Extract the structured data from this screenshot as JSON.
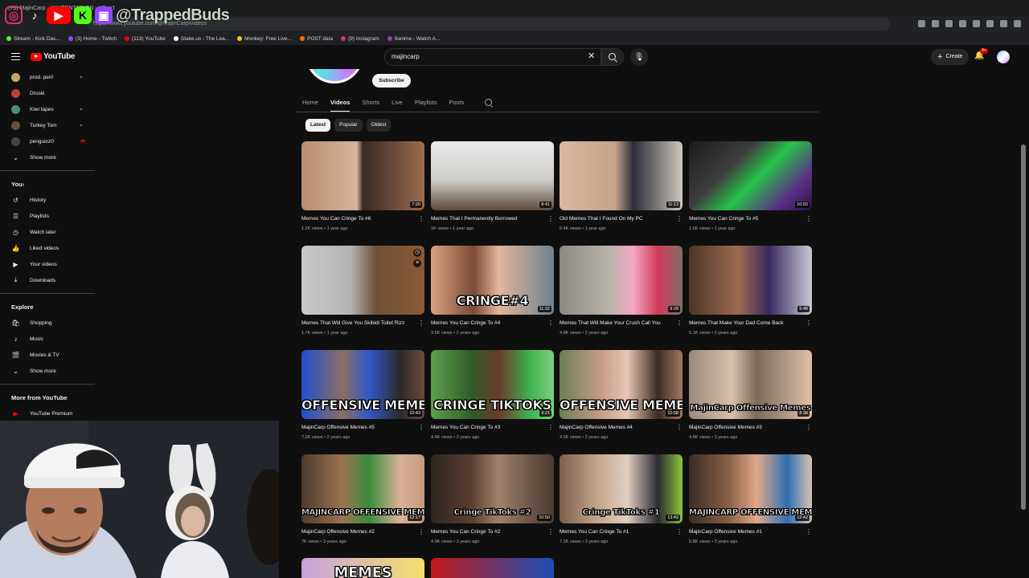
{
  "browser": {
    "tab_title": "(79) MajinCarp · XXXTENTACION - I Don't",
    "url": "https://www.youtube.com/@MajinCarp/videos",
    "watermark": "@TrappedBuds",
    "bookmarks": [
      {
        "label": "Stream - Kick Das...",
        "color": "#53fc18"
      },
      {
        "label": "(3) Home - Twitch",
        "color": "#9146ff"
      },
      {
        "label": "(113) YouTube",
        "color": "#ff0000"
      },
      {
        "label": "Stake.us - The Lea...",
        "color": "#ffffff"
      },
      {
        "label": "Monkey: Free Live...",
        "color": "#f5c518"
      },
      {
        "label": "POST data",
        "color": "#ff6d00"
      },
      {
        "label": "(9) Instagram",
        "color": "#e1306c"
      },
      {
        "label": "9anime - Watch A...",
        "color": "#8e44ad"
      }
    ]
  },
  "header": {
    "logo": "YouTube",
    "search_value": "majincarp",
    "create_label": "Create",
    "notif_count": "9+"
  },
  "sidebar": {
    "subscriptions": [
      {
        "label": "prod. peril",
        "color": "#c9a26b",
        "dot": true
      },
      {
        "label": "Druski",
        "color": "#b5432f",
        "dot": false
      },
      {
        "label": "Kiwi tapes",
        "color": "#4a8f7a",
        "dot": true
      },
      {
        "label": "Turkey Tom",
        "color": "#6a4c3c",
        "dot": true
      },
      {
        "label": "penguinz0",
        "color": "#444",
        "live": true
      }
    ],
    "show_more": "Show more",
    "you_heading": "You",
    "you_items": [
      {
        "label": "History",
        "icon": "history-icon",
        "glyph": "↺"
      },
      {
        "label": "Playlists",
        "icon": "playlists-icon",
        "glyph": "☰"
      },
      {
        "label": "Watch later",
        "icon": "clock-icon",
        "glyph": "◷"
      },
      {
        "label": "Liked videos",
        "icon": "thumbs-up-icon",
        "glyph": "👍"
      },
      {
        "label": "Your videos",
        "icon": "video-icon",
        "glyph": "▶"
      },
      {
        "label": "Downloads",
        "icon": "download-icon",
        "glyph": "⤓"
      }
    ],
    "explore_heading": "Explore",
    "explore_items": [
      {
        "label": "Shopping",
        "icon": "shopping-bag-icon",
        "glyph": "🛍"
      },
      {
        "label": "Music",
        "icon": "music-icon",
        "glyph": "♪"
      },
      {
        "label": "Movies & TV",
        "icon": "clapperboard-icon",
        "glyph": "🎬"
      }
    ],
    "explore_show_more": "Show more",
    "more_heading": "More from YouTube",
    "more_items": [
      {
        "label": "YouTube Premium",
        "icon": "youtube-premium-icon"
      }
    ]
  },
  "channel": {
    "subscribe_label": "Subscribe",
    "tabs": [
      "Home",
      "Videos",
      "Shorts",
      "Live",
      "Playlists",
      "Posts"
    ],
    "active_tab": "Videos",
    "chips": [
      "Latest",
      "Popular",
      "Oldest"
    ],
    "active_chip": "Latest"
  },
  "videos": [
    {
      "title": "Memes You Can Cringe To #6",
      "views": "1.2K views",
      "age": "1 year ago",
      "duration": "7:20",
      "overlay": "",
      "bg": "linear-gradient(90deg,#b98d6e 0%,#d8b49a 45%,#3a2a24 50%,#9c6b4e 100%)"
    },
    {
      "title": "Memes That I Permanently Borrowed",
      "views": "1K views",
      "age": "1 year ago",
      "duration": "8:41",
      "overlay": "",
      "bg": "linear-gradient(180deg,#e9e9e9 0%,#d0cfcb 55%,#5c4b3d 100%)"
    },
    {
      "title": "Old Memes That I Found On My PC",
      "views": "6.4K views",
      "age": "1 year ago",
      "duration": "11:13",
      "overlay": "",
      "bg": "linear-gradient(90deg,#d9b89f 0%,#c6a388 45%,#2d2e3a 60%,#cfc6bd 100%)"
    },
    {
      "title": "Memes You Can Cringe To #5",
      "views": "1.6K views",
      "age": "1 year ago",
      "duration": "10:02",
      "overlay": "",
      "bg": "linear-gradient(135deg,#1b1b1b 0%,#3e3e3e 35%,#27c24a 55%,#5a2f86 80%,#2a1440 100%)"
    },
    {
      "title": "Memes That Will Give You Skibidi Toilet Rizz",
      "views": "1.7K views",
      "age": "1 year ago",
      "duration": "",
      "overlay": "",
      "bg": "linear-gradient(90deg,#c9c9c9 0%,#b4b4b4 40%,#6e5138 60%,#8b5a36 100%)",
      "hover": true
    },
    {
      "title": "Memes You Can Cringe To #4",
      "views": "3.5K views",
      "age": "2 years ago",
      "duration": "11:32",
      "overlay": "CRINGE#4",
      "bg": "linear-gradient(90deg,#d9a07e 0%,#7a4b37 35%,#e2b69a 55%,#6d8290 100%)"
    },
    {
      "title": "Memes That Will Make Your Crush Call You",
      "views": "4.8K views",
      "age": "2 years ago",
      "duration": "9:28",
      "overlay": "",
      "bg": "linear-gradient(90deg,#8c8a84 0%,#b7b3aa 40%,#f4a7c5 60%,#d33a5a 80%,#7b6e63 100%)"
    },
    {
      "title": "Memes That Make Your Dad Come Back",
      "views": "5.1K views",
      "age": "2 years ago",
      "duration": "9:48",
      "overlay": "",
      "bg": "linear-gradient(90deg,#4e3527 0%,#9c6a50 40%,#3a2a60 65%,#c9c9d6 100%)"
    },
    {
      "title": "MajinCarp Offensive Memes #5",
      "views": "7.2K views",
      "age": "2 years ago",
      "duration": "10:43",
      "overlay": "OFFENSIVE MEMES",
      "bg": "linear-gradient(90deg,#1f4fd0 0%,#8a6f63 33%,#3258c9 55%,#2a2a2a 80%,#6b4a3b 100%)"
    },
    {
      "title": "Memes You Can Cringe To #3",
      "views": "4.4K views",
      "age": "2 years ago",
      "duration": "9:21",
      "overlay": "CRINGE TIKTOKS",
      "bg": "linear-gradient(90deg,#5da14b 0%,#2f5d2a 33%,#6a3a2b 55%,#3fb04f 80%,#7ad17c 100%)"
    },
    {
      "title": "MajinCarp Offensive Memes #4",
      "views": "4.5K views",
      "age": "2 years ago",
      "duration": "10:58",
      "overlay": "OFFENSIVE MEMES",
      "bg": "linear-gradient(90deg,#6c7f55 0%,#c59b85 33%,#e7c6b3 55%,#3d2a22 80%,#a17a65 100%)"
    },
    {
      "title": "MajinCarp Offensive Memes #3",
      "views": "4.8K views",
      "age": "3 years ago",
      "duration": "8:38",
      "overlay": "MajinCarp Offensive Memes",
      "bg": "linear-gradient(90deg,#9a8a7a 0%,#d8bfa8 35%,#7b6a5a 55%,#e0c1a8 100%)"
    },
    {
      "title": "MajinCarp Offensive Memes #2",
      "views": "7K views",
      "age": "3 years ago",
      "duration": "12:17",
      "overlay": "MAJINCARP OFFENSIVE MEMES",
      "bg": "linear-gradient(90deg,#4d3a2d 0%,#9c7251 33%,#3a8b3a 55%,#d9b299 80%,#c59980 100%)"
    },
    {
      "title": "Memes You Can Cringe To #2",
      "views": "4.9K views",
      "age": "3 years ago",
      "duration": "10:50",
      "overlay": "Cringe TikToks #2",
      "bg": "linear-gradient(90deg,#2c2521 0%,#5b3e30 33%,#a0826b 55%,#6c5749 80%,#4a3b31 100%)"
    },
    {
      "title": "Memes You Can Cringe To #1",
      "views": "7.2K views",
      "age": "3 years ago",
      "duration": "13:42",
      "overlay": "Cringe TikToks #1",
      "bg": "linear-gradient(90deg,#7c5f4b 0%,#c7a98f 33%,#e0cfc1 55%,#2b2b33 80%,#8ec23a 100%)"
    },
    {
      "title": "MajinCarp Offensive Memes #1",
      "views": "5.8K views",
      "age": "3 years ago",
      "duration": "12:42",
      "overlay": "MAJINCARP OFFENSIVE MEME",
      "bg": "linear-gradient(90deg,#3a2c24 0%,#8a6148 33%,#e2a98a 55%,#2f6fb1 80%,#d9c2b3 100%)"
    }
  ],
  "partial_row": [
    {
      "overlay": "MEMES",
      "bg": "linear-gradient(90deg,#c7a0e0,#f5e06b)"
    },
    {
      "overlay": "",
      "bg": "linear-gradient(90deg,#c21a1a,#1c4fb5)"
    }
  ]
}
